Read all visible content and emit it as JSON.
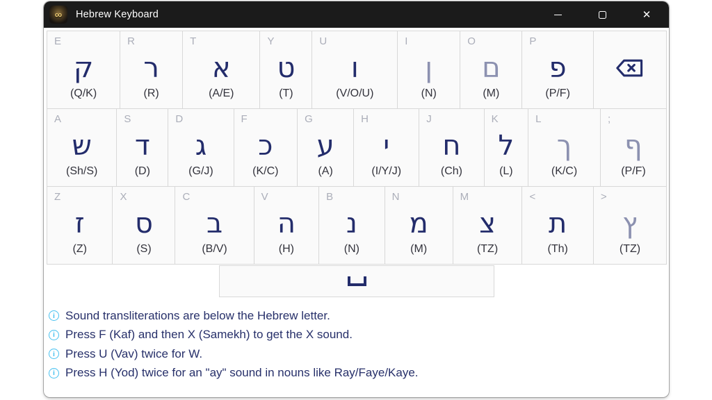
{
  "window": {
    "title": "Hebrew Keyboard",
    "app_icon_glyph": "∞",
    "controls": {
      "close_glyph": "✕"
    }
  },
  "colors": {
    "titlebar_bg": "#1b1b1b",
    "hebrew_regular": "#232c6b",
    "hebrew_final": "#8c91b0",
    "key_corner_label": "#abaeb9",
    "info_icon": "#47c1f0",
    "info_text": "#27306a"
  },
  "keyboard": {
    "space_key_icon": "open-box-space-symbol",
    "backspace_key_icon": "backspace-arrow",
    "rows": [
      [
        {
          "key": "E",
          "hebrew": "ק",
          "translit": "(Q/K)"
        },
        {
          "key": "R",
          "hebrew": "ר",
          "translit": "(R)"
        },
        {
          "key": "T",
          "hebrew": "א",
          "translit": "(A/E)"
        },
        {
          "key": "Y",
          "hebrew": "ט",
          "translit": "(T)"
        },
        {
          "key": "U",
          "hebrew": "ו",
          "translit": "(V/O/U)"
        },
        {
          "key": "I",
          "hebrew": "ן",
          "translit": "(N)",
          "final": true
        },
        {
          "key": "O",
          "hebrew": "ם",
          "translit": "(M)",
          "final": true
        },
        {
          "key": "P",
          "hebrew": "פ",
          "translit": "(P/F)"
        },
        {
          "type": "backspace"
        }
      ],
      [
        {
          "key": "A",
          "hebrew": "ש",
          "translit": "(Sh/S)"
        },
        {
          "key": "S",
          "hebrew": "ד",
          "translit": "(D)"
        },
        {
          "key": "D",
          "hebrew": "ג",
          "translit": "(G/J)"
        },
        {
          "key": "F",
          "hebrew": "כ",
          "translit": "(K/C)"
        },
        {
          "key": "G",
          "hebrew": "ע",
          "translit": "(A)"
        },
        {
          "key": "H",
          "hebrew": "י",
          "translit": "(I/Y/J)"
        },
        {
          "key": "J",
          "hebrew": "ח",
          "translit": "(Ch)"
        },
        {
          "key": "K",
          "hebrew": "ל",
          "translit": "(L)"
        },
        {
          "key": "L",
          "hebrew": "ך",
          "translit": "(K/C)",
          "final": true
        },
        {
          "key": ";",
          "hebrew": "ף",
          "translit": "(P/F)",
          "final": true
        }
      ],
      [
        {
          "key": "Z",
          "hebrew": "ז",
          "translit": "(Z)"
        },
        {
          "key": "X",
          "hebrew": "ס",
          "translit": "(S)"
        },
        {
          "key": "C",
          "hebrew": "ב",
          "translit": "(B/V)"
        },
        {
          "key": "V",
          "hebrew": "ה",
          "translit": "(H)"
        },
        {
          "key": "B",
          "hebrew": "נ",
          "translit": "(N)"
        },
        {
          "key": "N",
          "hebrew": "מ",
          "translit": "(M)"
        },
        {
          "key": "M",
          "hebrew": "צ",
          "translit": "(TZ)"
        },
        {
          "key": "<",
          "hebrew": "ת",
          "translit": "(Th)"
        },
        {
          "key": ">",
          "hebrew": "ץ",
          "translit": "(TZ)",
          "final": true
        }
      ]
    ]
  },
  "notes": [
    "Sound transliterations are below the Hebrew letter.",
    "Press F (Kaf) and then X (Samekh) to get the X sound.",
    "Press U (Vav) twice for W.",
    "Press H (Yod) twice for an \"ay\" sound in nouns like Ray/Faye/Kaye."
  ]
}
